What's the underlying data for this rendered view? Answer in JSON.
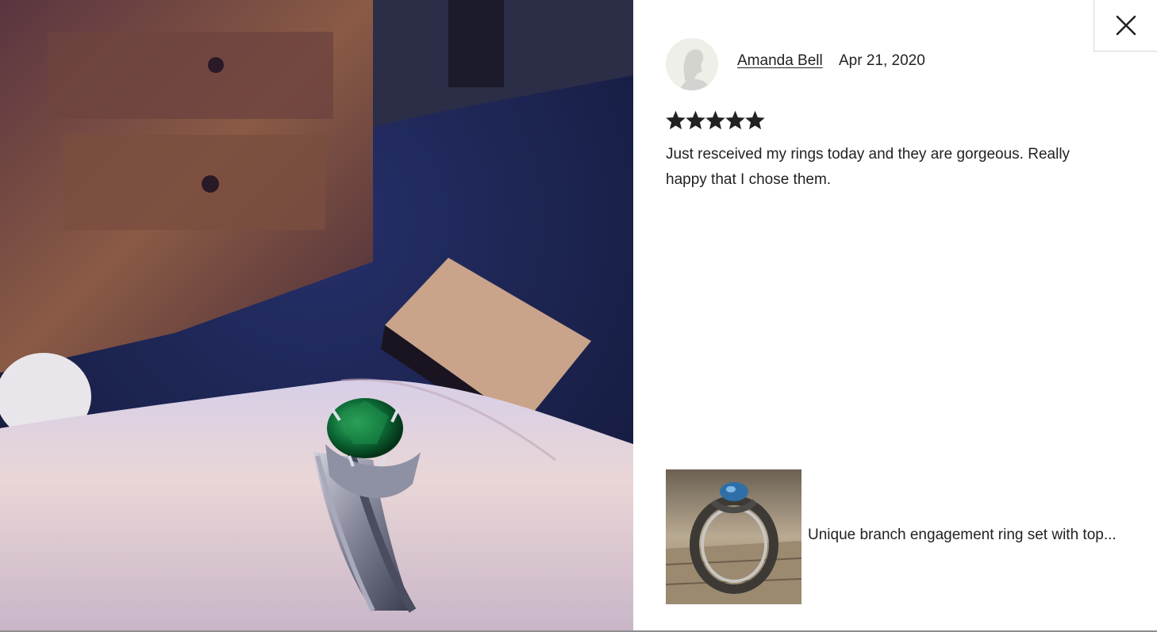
{
  "review": {
    "reviewer_name": "Amanda Bell",
    "date": "Apr 21, 2020",
    "rating": 5,
    "max_rating": 5,
    "text": "Just resceived my rings today and they are gorgeous. Really happy that I chose them."
  },
  "listing": {
    "title": "Unique branch engagement ring set with top..."
  },
  "icons": {
    "close": "close-icon",
    "star": "star-icon",
    "avatar": "default-avatar-icon"
  },
  "colors": {
    "text": "#222222",
    "star": "#222222",
    "border": "#d6d6d6"
  }
}
